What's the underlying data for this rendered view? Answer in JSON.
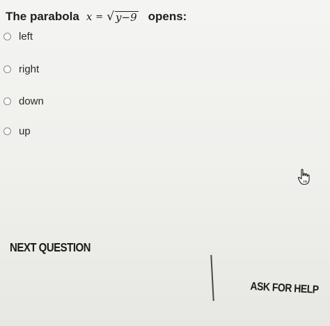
{
  "question": {
    "prefix": "The parabola",
    "equation": {
      "lhs": "x",
      "eq": "=",
      "radicand": "y−9"
    },
    "suffix": "opens:"
  },
  "options": [
    {
      "label": "left"
    },
    {
      "label": "right"
    },
    {
      "label": "down"
    },
    {
      "label": "up"
    }
  ],
  "buttons": {
    "next": "NEXT QUESTION",
    "help": "ASK FOR HELP"
  },
  "icons": {
    "cursor": "hand-pointer-icon"
  }
}
